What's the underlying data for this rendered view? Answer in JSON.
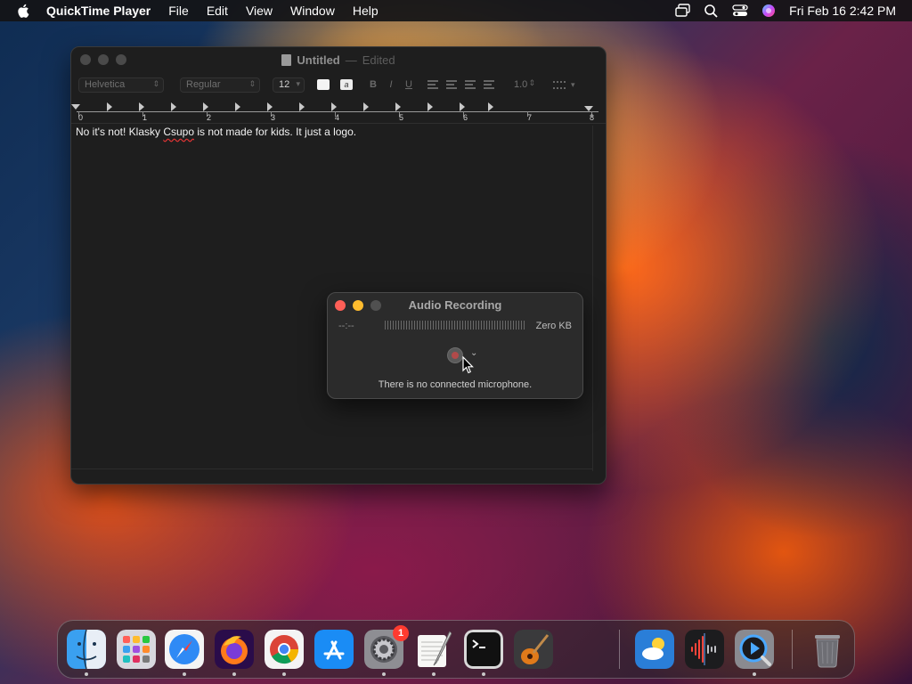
{
  "menubar": {
    "app_name": "QuickTime Player",
    "items": [
      "File",
      "Edit",
      "View",
      "Window",
      "Help"
    ],
    "clock": "Fri Feb 16  2:42 PM"
  },
  "textedit": {
    "title": "Untitled",
    "separator": "—",
    "edited": "Edited",
    "toolbar": {
      "font_family": "Helvetica",
      "font_style": "Regular",
      "font_size": "12",
      "bold": "B",
      "italic": "I",
      "underline": "U",
      "line_spacing": "1.0"
    },
    "ruler_numbers": [
      "0",
      "1",
      "2",
      "3",
      "4",
      "5",
      "6",
      "7",
      "8"
    ],
    "text_before": "No it's not! Klasky ",
    "text_misspelled": "Csupo",
    "text_after": " is not made for kids. It just a logo."
  },
  "audio_window": {
    "title": "Audio Recording",
    "time": "--:--",
    "size": "Zero KB",
    "status": "There is no connected microphone."
  },
  "dock": {
    "settings_badge": "1"
  }
}
